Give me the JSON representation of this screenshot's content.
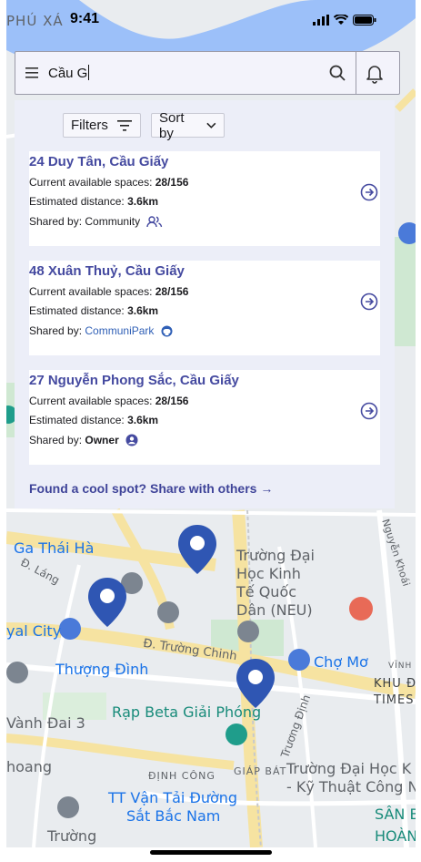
{
  "status_bar": {
    "location": "PHÚ XÁ",
    "time": "9:41"
  },
  "search": {
    "query": "Cầu G"
  },
  "toolbar": {
    "filters_label": "Filters",
    "sort_label": "Sort by"
  },
  "results": [
    {
      "title": "24 Duy Tân, Cầu Giấy",
      "spaces_label": "Current available spaces:",
      "spaces_value": "28/156",
      "distance_label": "Estimated distance:",
      "distance_value": "3.6km",
      "shared_label": "Shared by:",
      "shared_by": "Community",
      "shared_icon": "people-icon"
    },
    {
      "title": "48 Xuân Thuỷ, Cầu Giấy",
      "spaces_label": "Current available spaces:",
      "spaces_value": "28/156",
      "distance_label": "Estimated distance:",
      "distance_value": "3.6km",
      "shared_label": "Shared by:",
      "shared_by": "CommuniPark",
      "shared_icon": "github-icon"
    },
    {
      "title": "27 Nguyễn Phong Sắc, Cầu Giấy",
      "spaces_label": "Current available spaces:",
      "spaces_value": "28/156",
      "distance_label": "Estimated distance:",
      "distance_value": "3.6km",
      "shared_label": "Shared by:",
      "shared_by": "Owner",
      "shared_icon": "user-circle-icon"
    }
  ],
  "share_cta": "Found a cool spot? Share with others →",
  "map_labels": {
    "ga_thai_ha": "Ga Thái Hà",
    "truong_dai_hoc_kinh_te": [
      "Trường Đại",
      "Học Kinh",
      "Tế Quốc",
      "Dân (NEU)"
    ],
    "d_lang": "Đ. Láng",
    "yal_city": "yal City",
    "d_truong_chinh": "Đ. Trường Chinh",
    "cho_mo": "Chợ Mơ",
    "thuong_dinh": "Thượng Đình",
    "rap_beta": "Rạp Beta Giải Phóng",
    "vanh_dai_3": "Vành Đai 3",
    "truong_dinh": "Trương Định",
    "dinh_cong": "ĐỊNH CÔNG",
    "giap_bat": "GIÁP BÁT",
    "truong_dh_kt": [
      "Trường Đại Học K",
      "- Kỹ Thuật Công N"
    ],
    "tt_van_tai": [
      "TT Vận Tải Đường",
      "Sắt Bắc Nam"
    ],
    "san_bay": [
      "SÂN B",
      "HOÀNG"
    ],
    "khu_d": [
      "KHU Đ",
      "TIMES"
    ],
    "vinh": "VĨNH",
    "nguyen_khoai": "Nguyễn Khoái",
    "hoang": "hoang",
    "truong_bottom": "Trường"
  },
  "colors": {
    "accent": "#454aa0",
    "pin": "#2f56b3",
    "panel": "#eceef8"
  }
}
